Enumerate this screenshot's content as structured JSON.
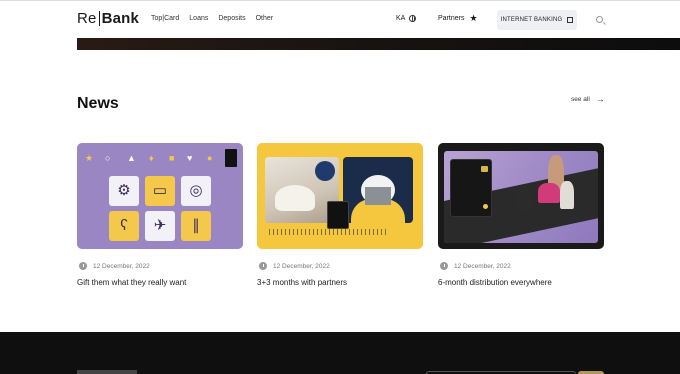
{
  "header": {
    "logo_re": "Re",
    "logo_bank": "Bank",
    "nav": [
      "Top|Card",
      "Loans",
      "Deposits",
      "Other"
    ],
    "language": "KA",
    "partners_label": "Partners",
    "internet_banking_label": "INTERNET BANKING"
  },
  "news": {
    "title": "News",
    "see_all": "see all",
    "items": [
      {
        "date": "12 December, 2022",
        "title": "Gift them what they really want",
        "theme_color": "#9b86c4"
      },
      {
        "date": "12 December, 2022",
        "title": "3+3 months with partners",
        "theme_color": "#f4c73e"
      },
      {
        "date": "12 December, 2022",
        "title": "6-month distribution everywhere",
        "theme_color": "#1a1a1a"
      }
    ]
  },
  "icons": {
    "language": "globe-icon",
    "partners": "star-icon",
    "internet_banking": "external-link-icon",
    "search": "search-icon",
    "see_all": "arrow-right-icon",
    "date": "clock-icon"
  }
}
